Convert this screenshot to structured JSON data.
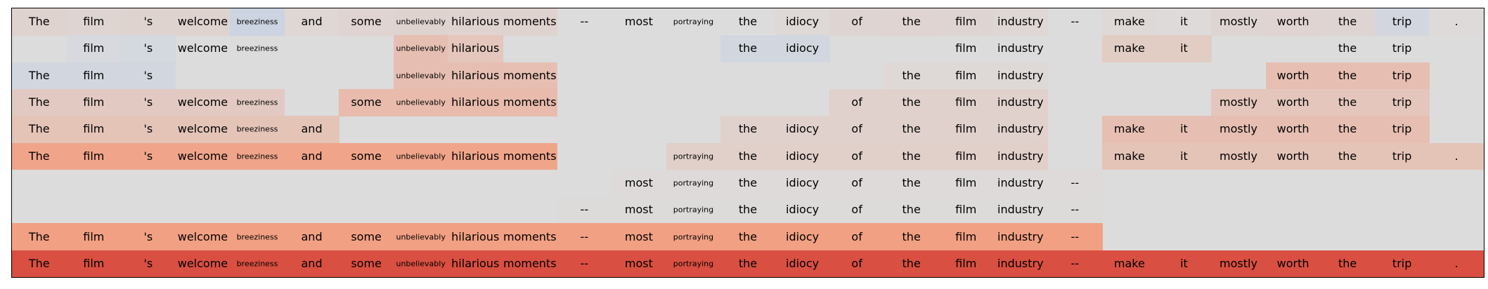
{
  "chart_data": {
    "type": "heatmap",
    "columns": [
      "The",
      "film",
      "'s",
      "welcome",
      "breeziness",
      "and",
      "some",
      "unbelievably",
      "hilarious",
      "moments",
      "--",
      "most",
      "portraying",
      "the",
      "idiocy",
      "of",
      "the",
      "film",
      "industry",
      "--",
      "make",
      "it",
      "mostly",
      "worth",
      "the",
      "trip",
      "."
    ],
    "rows": [
      {
        "tokens": [
          "The",
          "film",
          "'s",
          "welcome",
          "breeziness",
          "and",
          "some",
          "unbelievably",
          "hilarious",
          "moments",
          "--",
          "most",
          "portraying",
          "the",
          "idiocy",
          "of",
          "the",
          "film",
          "industry",
          "--",
          "make",
          "it",
          "mostly",
          "worth",
          "the",
          "trip",
          "."
        ],
        "values": [
          0.08,
          0.06,
          0.08,
          0.08,
          -0.15,
          0.05,
          0.07,
          0.08,
          0.08,
          0.08,
          0.0,
          0.0,
          0.0,
          0.0,
          0.04,
          0.06,
          0.07,
          0.06,
          0.05,
          0.0,
          0.04,
          0.02,
          0.06,
          0.07,
          0.06,
          -0.1,
          0.02
        ]
      },
      {
        "tokens": [
          null,
          "film",
          "'s",
          "welcome",
          "breeziness",
          null,
          null,
          "unbelievably",
          "hilarious",
          null,
          null,
          null,
          null,
          "the",
          "idiocy",
          null,
          null,
          "film",
          "industry",
          null,
          "make",
          "it",
          null,
          null,
          "the",
          "trip",
          null
        ],
        "values": [
          0.0,
          -0.05,
          -0.08,
          0.0,
          0.0,
          0.0,
          0.0,
          0.26,
          0.2,
          0.0,
          0.0,
          0.0,
          0.0,
          -0.1,
          -0.1,
          0.0,
          0.0,
          0.0,
          0.0,
          0.0,
          0.14,
          0.14,
          0.0,
          0.0,
          0.0,
          0.0,
          0.0
        ]
      },
      {
        "tokens": [
          "The",
          "film",
          "'s",
          null,
          null,
          null,
          null,
          "unbelievably",
          "hilarious",
          "moments",
          null,
          null,
          null,
          null,
          null,
          null,
          "the",
          "film",
          "industry",
          null,
          null,
          null,
          null,
          "worth",
          "the",
          "trip",
          null
        ],
        "values": [
          -0.1,
          -0.1,
          -0.1,
          0.0,
          0.0,
          0.0,
          0.0,
          0.26,
          0.26,
          0.26,
          0.0,
          0.0,
          0.0,
          0.0,
          0.0,
          0.0,
          0.04,
          0.04,
          0.04,
          0.0,
          0.0,
          0.0,
          0.0,
          0.26,
          0.26,
          0.26,
          0.0
        ]
      },
      {
        "tokens": [
          "The",
          "film",
          "'s",
          "welcome",
          "breeziness",
          null,
          "some",
          "unbelievably",
          "hilarious",
          "moments",
          null,
          null,
          null,
          null,
          null,
          "of",
          "the",
          "film",
          "industry",
          null,
          null,
          null,
          "mostly",
          "worth",
          "the",
          "trip",
          null
        ],
        "values": [
          0.16,
          0.16,
          0.16,
          0.16,
          0.16,
          0.0,
          0.3,
          0.3,
          0.3,
          0.3,
          0.0,
          0.0,
          0.0,
          0.0,
          0.0,
          0.1,
          0.1,
          0.1,
          0.1,
          0.0,
          0.0,
          0.0,
          0.2,
          0.2,
          0.2,
          0.2,
          0.0
        ]
      },
      {
        "tokens": [
          "The",
          "film",
          "'s",
          "welcome",
          "breeziness",
          "and",
          null,
          null,
          null,
          null,
          null,
          null,
          null,
          "the",
          "idiocy",
          "of",
          "the",
          "film",
          "industry",
          null,
          "make",
          "it",
          "mostly",
          "worth",
          "the",
          "trip",
          null
        ],
        "values": [
          0.22,
          0.22,
          0.22,
          0.22,
          0.22,
          0.22,
          0.0,
          0.0,
          0.0,
          0.0,
          0.0,
          0.0,
          0.0,
          0.1,
          0.1,
          0.1,
          0.1,
          0.1,
          0.1,
          0.0,
          0.26,
          0.26,
          0.26,
          0.26,
          0.26,
          0.26,
          0.0
        ]
      },
      {
        "tokens": [
          "The",
          "film",
          "'s",
          "welcome",
          "breeziness",
          "and",
          "some",
          "unbelievably",
          "hilarious",
          "moments",
          null,
          null,
          "portraying",
          "the",
          "idiocy",
          "of",
          "the",
          "film",
          "industry",
          null,
          "make",
          "it",
          "mostly",
          "worth",
          "the",
          "trip",
          "."
        ],
        "values": [
          0.5,
          0.5,
          0.5,
          0.5,
          0.5,
          0.5,
          0.5,
          0.5,
          0.5,
          0.5,
          0.0,
          0.0,
          0.12,
          0.12,
          0.12,
          0.12,
          0.12,
          0.12,
          0.12,
          0.0,
          0.22,
          0.22,
          0.22,
          0.22,
          0.22,
          0.22,
          0.22
        ]
      },
      {
        "tokens": [
          null,
          null,
          null,
          null,
          null,
          null,
          null,
          null,
          null,
          null,
          null,
          "most",
          "portraying",
          "the",
          "idiocy",
          "of",
          "the",
          "film",
          "industry",
          "--",
          null,
          null,
          null,
          null,
          null,
          null,
          null
        ],
        "values": [
          0.0,
          0.0,
          0.0,
          0.0,
          0.0,
          0.0,
          0.0,
          0.0,
          0.0,
          0.0,
          0.0,
          0.02,
          0.02,
          0.02,
          0.02,
          0.02,
          0.02,
          0.02,
          0.02,
          0.02,
          0.0,
          0.0,
          0.0,
          0.0,
          0.0,
          0.0,
          0.0
        ]
      },
      {
        "tokens": [
          null,
          null,
          null,
          null,
          null,
          null,
          null,
          null,
          null,
          null,
          "--",
          "most",
          "portraying",
          "the",
          "idiocy",
          "of",
          "the",
          "film",
          "industry",
          "--",
          null,
          null,
          null,
          null,
          null,
          null,
          null
        ],
        "values": [
          0.0,
          0.0,
          0.0,
          0.0,
          0.0,
          0.0,
          0.0,
          0.0,
          0.0,
          0.0,
          0.01,
          0.01,
          0.01,
          0.01,
          0.01,
          0.01,
          0.01,
          0.01,
          0.01,
          0.01,
          0.0,
          0.0,
          0.0,
          0.0,
          0.0,
          0.0,
          0.0
        ]
      },
      {
        "tokens": [
          "The",
          "film",
          "'s",
          "welcome",
          "breeziness",
          "and",
          "some",
          "unbelievably",
          "hilarious",
          "moments",
          "--",
          "most",
          "portraying",
          "the",
          "idiocy",
          "of",
          "the",
          "film",
          "industry",
          "--",
          null,
          null,
          null,
          null,
          null,
          null,
          null
        ],
        "values": [
          0.55,
          0.55,
          0.55,
          0.55,
          0.55,
          0.55,
          0.55,
          0.55,
          0.55,
          0.55,
          0.55,
          0.55,
          0.55,
          0.55,
          0.55,
          0.55,
          0.55,
          0.55,
          0.55,
          0.55,
          0.0,
          0.0,
          0.0,
          0.0,
          0.0,
          0.0,
          0.0
        ]
      },
      {
        "tokens": [
          "The",
          "film",
          "'s",
          "welcome",
          "breeziness",
          "and",
          "some",
          "unbelievably",
          "hilarious",
          "moments",
          "--",
          "most",
          "portraying",
          "the",
          "idiocy",
          "of",
          "the",
          "film",
          "industry",
          "--",
          "make",
          "it",
          "mostly",
          "worth",
          "the",
          "trip",
          "."
        ],
        "values": [
          0.92,
          0.92,
          0.92,
          0.92,
          0.92,
          0.92,
          0.92,
          0.92,
          0.92,
          0.92,
          0.92,
          0.92,
          0.92,
          0.92,
          0.92,
          0.92,
          0.92,
          0.92,
          0.92,
          0.92,
          0.92,
          0.92,
          0.92,
          0.92,
          0.92,
          0.92,
          0.92
        ]
      }
    ],
    "colormap": "coolwarm",
    "vrange": [
      -1,
      1
    ],
    "colors": {
      "background": "#dcdcdc",
      "negative": "#3b4cc0",
      "positive": "#b40426"
    },
    "xlabel": "",
    "ylabel": "",
    "title": "",
    "grid": false,
    "legend": "none"
  }
}
